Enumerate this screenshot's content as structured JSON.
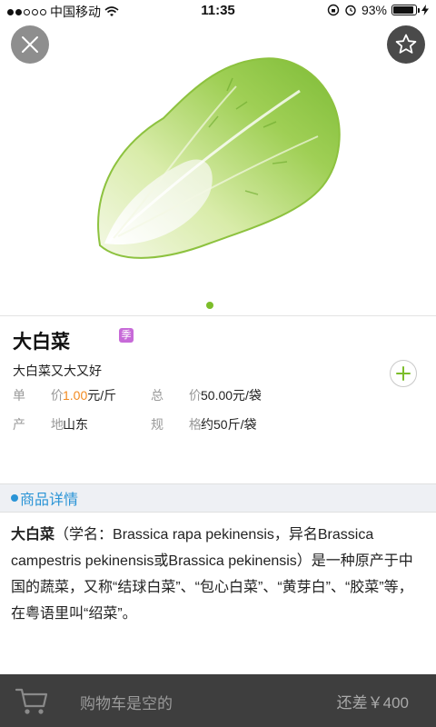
{
  "status_bar": {
    "carrier": "中国移动",
    "time": "11:35",
    "battery_percent": "93%",
    "battery_level": 0.93
  },
  "product": {
    "name": "大白菜",
    "season_badge": "季",
    "tagline": "大白菜又大又好",
    "unit_price_label": "单 价",
    "unit_price_value": "1.00",
    "unit_price_unit": "元/斤",
    "total_price_label": "总 价",
    "total_price_value": "50.00元/袋",
    "origin_label": "产 地",
    "origin_value": "山东",
    "spec_label": "规 格",
    "spec_value": "约50斤/袋"
  },
  "details": {
    "header": "商品详情",
    "desc_name": "大白菜",
    "desc_body": "（学名：Brassica rapa pekinensis，异名Brassica campestris pekinensis或Brassica pekinensis）是一种原产于中国的蔬菜，又称“结球白菜”、“包心白菜”、“黄芽白”、“胶菜”等，在粤语里叫“绍菜”。"
  },
  "cart": {
    "status": "购物车是空的",
    "difference": "还差￥400"
  },
  "icons": {
    "close": "close-icon",
    "favorite": "star-icon",
    "add": "plus-icon",
    "cart": "cart-icon"
  },
  "colors": {
    "accent_green": "#7cbd2a",
    "price_orange": "#f28a1f",
    "section_blue": "#2a94d6",
    "badge_purple": "#c76ad8",
    "bottom_bar": "#3e3e3e"
  }
}
